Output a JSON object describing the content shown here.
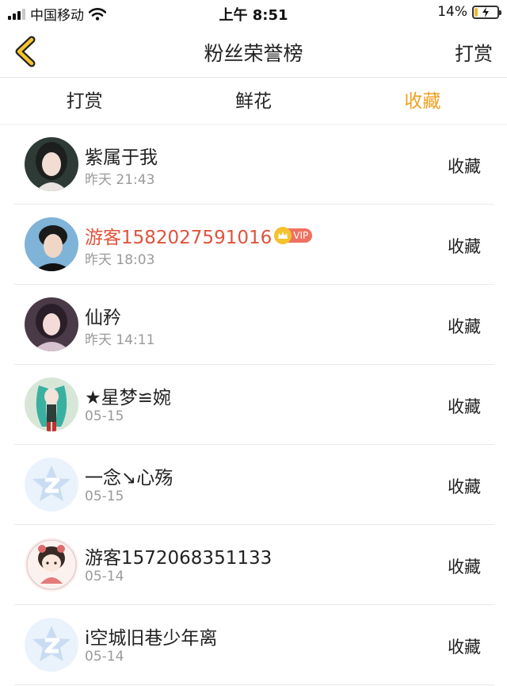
{
  "status_bar": {
    "carrier": "中国移动",
    "time": "上午 8:51",
    "battery": "14%",
    "battery_level": 0.14
  },
  "header": {
    "title": "粉丝荣誉榜",
    "right_action": "打赏"
  },
  "tabs": [
    {
      "label": "打赏",
      "active": false
    },
    {
      "label": "鲜花",
      "active": false
    },
    {
      "label": "收藏",
      "active": true
    }
  ],
  "colors": {
    "accent": "#f0a020",
    "vip_name": "#e0533c",
    "vip_tag": "#f07060"
  },
  "rows": [
    {
      "name": "紫属于我",
      "time": "昨天 21:43",
      "action": "收藏",
      "vip": false,
      "vip_tag": ""
    },
    {
      "name": "游客1582027591016",
      "time": "昨天 18:03",
      "action": "收藏",
      "vip": true,
      "vip_tag": "VIP"
    },
    {
      "name": "仙矜",
      "time": "昨天 14:11",
      "action": "收藏",
      "vip": false,
      "vip_tag": ""
    },
    {
      "name": "★星梦≌婉",
      "time": "05-15",
      "action": "收藏",
      "vip": false,
      "vip_tag": ""
    },
    {
      "name": "一念↘心殇",
      "time": "05-15",
      "action": "收藏",
      "vip": false,
      "vip_tag": ""
    },
    {
      "name": "游客1572068351133",
      "time": "05-14",
      "action": "收藏",
      "vip": false,
      "vip_tag": ""
    },
    {
      "name": "i空城旧巷少年离",
      "time": "05-14",
      "action": "收藏",
      "vip": false,
      "vip_tag": ""
    }
  ]
}
